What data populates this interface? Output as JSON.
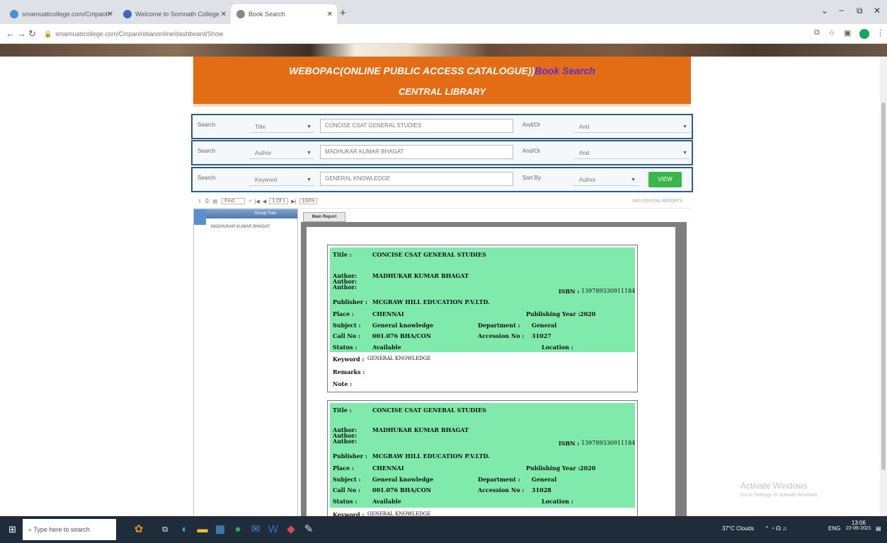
{
  "browser": {
    "tabs": [
      {
        "label": "smamuaticollege.com/Cmpanb"
      },
      {
        "label": "Welcome to Somnath College"
      },
      {
        "label": "Book Search"
      }
    ],
    "url": "smamuaticollege.com/Cmpanl/ebanonline/dashboard/Show",
    "new_tab": "+",
    "minimize": "−",
    "maximize": "⧉",
    "close": "✕"
  },
  "header": {
    "title": "WEBOPAC(ONLINE PUBLIC ACCESS CATALOGUE))",
    "book_search_link": "Book Search",
    "subtitle": "CENTRAL LIBRARY"
  },
  "search_rows": [
    {
      "label": "Search",
      "field": "Title",
      "value": "CONCISE CSAT GENERAL STUDIES",
      "op_label": "And/Or",
      "op_value": "And"
    },
    {
      "label": "Search",
      "field": "Author",
      "value": "MADHUKAR KUMAR BHAGAT",
      "op_label": "And/Or",
      "op_value": "And"
    },
    {
      "label": "Search",
      "field": "Keyword",
      "value": "GENERAL KNOWLEDGE",
      "op_label": "Sort By",
      "op_value": "Author"
    }
  ],
  "view_button": "VIEW",
  "toolbar": {
    "find_value": "Find",
    "page_info": "1 Of 1",
    "zoom": "100%",
    "right_note": "SAP CRYSTAL REPORTS"
  },
  "tree": {
    "header": "Group Tree",
    "item": "MADHUKAR KUMAR BHAGAT"
  },
  "viewer": {
    "tab_label": "Main Report"
  },
  "records": [
    {
      "title_label": "Title :",
      "title": "CONCISE CSAT GENERAL STUDIES",
      "author_label": "Author:",
      "author": "MADHUKAR KUMAR BHAGAT",
      "isbn_label": "ISBN :",
      "isbn": "139789330911184",
      "publisher_label": "Publisher :",
      "publisher": "MCGRAW HILL EDUCATION P.V.LTD.",
      "place_label": "Place :",
      "place": "CHENNAI",
      "pub_year_label": "Publishing Year :",
      "pub_year": "2020",
      "subject_label": "Subject :",
      "subject": "General knowledge",
      "department_label": "Department :",
      "department": "General",
      "call_no_label": "Call No :",
      "call_no": "001.076 BHA/CON",
      "accession_label": "Accession No :",
      "accession": "31027",
      "status_label": "Status :",
      "status": "Available",
      "location_label": "Location :",
      "keyword_label": "Keyword :",
      "keyword": "GENERAL KNOWLEDGE",
      "remarks_label": "Remarks :",
      "note_label": "Note :"
    },
    {
      "title_label": "Title :",
      "title": "CONCISE CSAT GENERAL STUDIES",
      "author_label": "Author:",
      "author": "MADHUKAR KUMAR BHAGAT",
      "isbn_label": "ISBN :",
      "isbn": "139789330911184",
      "publisher_label": "Publisher :",
      "publisher": "MCGRAW HILL EDUCATION P.V.LTD.",
      "place_label": "Place :",
      "place": "CHENNAI",
      "pub_year_label": "Publishing Year :",
      "pub_year": "2020",
      "subject_label": "Subject :",
      "subject": "General knowledge",
      "department_label": "Department :",
      "department": "General",
      "call_no_label": "Call No :",
      "call_no": "001.076 BHA/CON",
      "accession_label": "Accession No :",
      "accession": "31028",
      "status_label": "Status :",
      "status": "Available",
      "location_label": "Location :",
      "keyword_label": "Keyword :",
      "keyword": "GENERAL KNOWLEDGE"
    }
  ],
  "watermark": {
    "line1": "Activate Windows",
    "line2": "Go to Settings to activate Windows."
  },
  "taskbar": {
    "search_placeholder": "Type here to search",
    "weather": "37°C Clouds",
    "time": "13:06",
    "date": "22-06-2021",
    "lang": "ENG"
  },
  "colors": {
    "header_orange": "#e36d15",
    "record_green": "#80eaab",
    "view_button": "#3bb64a",
    "search_border": "#2f5a84"
  }
}
